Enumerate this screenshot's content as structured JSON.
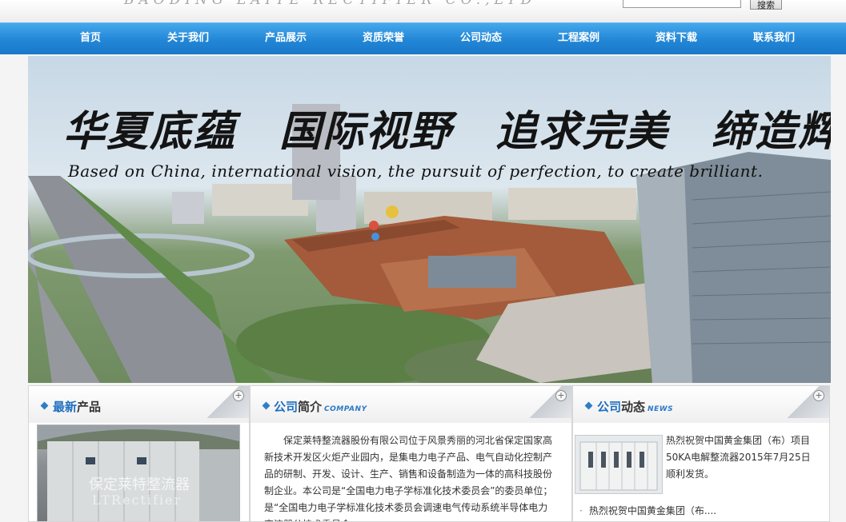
{
  "header": {
    "logo_subtitle": "BAODING LAITE RECTIFIER CO.,LTD",
    "search_placeholder": "",
    "search_button": "搜索"
  },
  "nav": {
    "items": [
      {
        "label": "首页"
      },
      {
        "label": "关于我们"
      },
      {
        "label": "产品展示"
      },
      {
        "label": "资质荣誉"
      },
      {
        "label": "公司动态"
      },
      {
        "label": "工程案例"
      },
      {
        "label": "资料下载"
      },
      {
        "label": "联系我们"
      }
    ]
  },
  "banner": {
    "slogan_cn": "华夏底蕴　国际视野　追求完美　缔造辉煌",
    "slogan_en": "Based on China, international vision, the pursuit of perfection, to create brilliant."
  },
  "products": {
    "title_blue": "最新",
    "title_dark": "产品",
    "watermark_cn": "保定莱特整流器",
    "watermark_en": "LTRectifier"
  },
  "company": {
    "title_blue": "公司",
    "title_dark": "简介",
    "title_en": "COMPANY",
    "intro": "保定莱特整流器股份有限公司位于风景秀丽的河北省保定国家高新技术开发区火炬产业园内，是集电力电子产品、电气自动化控制产品的研制、开发、设计、生产、销售和设备制造为一体的高科技股份制企业。本公司是“全国电力电子学标准化技术委员会”的委员单位；是“全国电力电子学标准化技术委员会调速电气传动系统半导体电力变流器分技术委员会"
  },
  "news": {
    "title_blue": "公司",
    "title_dark": "动态",
    "title_en": "NEWS",
    "featured": "热烈祝贺中国黄金集团（布）项目50KA电解整流器2015年7月25日顺利发货。",
    "list": [
      {
        "text": "热烈祝贺中国黄金集团（布...."
      }
    ]
  },
  "colors": {
    "nav_blue": "#2286d6",
    "accent_blue": "#1f6fbf"
  }
}
